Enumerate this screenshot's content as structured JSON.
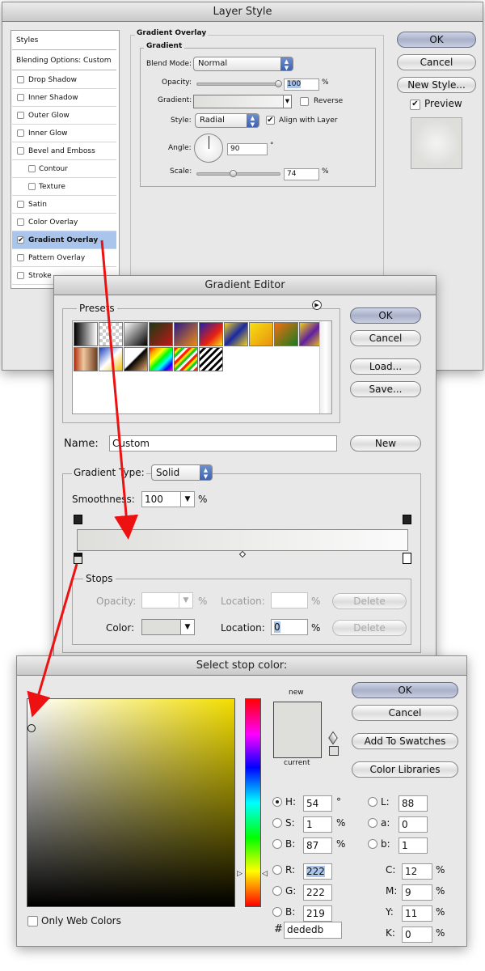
{
  "layer_style": {
    "title": "Layer Style",
    "styles_header": "Styles",
    "blending_options": "Blending Options: Custom",
    "effects": [
      {
        "label": "Drop Shadow",
        "checked": false
      },
      {
        "label": "Inner Shadow",
        "checked": false
      },
      {
        "label": "Outer Glow",
        "checked": false
      },
      {
        "label": "Inner Glow",
        "checked": false
      },
      {
        "label": "Bevel and Emboss",
        "checked": false
      },
      {
        "label": "Contour",
        "checked": false
      },
      {
        "label": "Texture",
        "checked": false
      },
      {
        "label": "Satin",
        "checked": false
      },
      {
        "label": "Color Overlay",
        "checked": false
      },
      {
        "label": "Gradient Overlay",
        "checked": true
      },
      {
        "label": "Pattern Overlay",
        "checked": false
      },
      {
        "label": "Stroke",
        "checked": false
      }
    ],
    "section_title": "Gradient Overlay",
    "group_title": "Gradient",
    "blend_mode_label": "Blend Mode:",
    "blend_mode_value": "Normal",
    "opacity_label": "Opacity:",
    "opacity_value": "100",
    "opacity_unit": "%",
    "gradient_label": "Gradient:",
    "reverse_label": "Reverse",
    "style_label": "Style:",
    "style_value": "Radial",
    "align_label": "Align with Layer",
    "angle_label": "Angle:",
    "angle_value": "90",
    "angle_unit": "°",
    "scale_label": "Scale:",
    "scale_value": "74",
    "scale_unit": "%",
    "ok": "OK",
    "cancel": "Cancel",
    "new_style": "New Style...",
    "preview": "Preview"
  },
  "gradient_editor": {
    "title": "Gradient Editor",
    "presets_label": "Presets",
    "ok": "OK",
    "cancel": "Cancel",
    "load": "Load...",
    "save": "Save...",
    "name_label": "Name:",
    "name_value": "Custom",
    "new": "New",
    "type_label": "Gradient Type:",
    "type_value": "Solid",
    "smoothness_label": "Smoothness:",
    "smoothness_value": "100",
    "smoothness_unit": "%",
    "stops_label": "Stops",
    "opacity_label": "Opacity:",
    "opacity_unit": "%",
    "location_label": "Location:",
    "location_unit": "%",
    "delete": "Delete",
    "color_label": "Color:",
    "location_value": "0"
  },
  "color_picker": {
    "title": "Select stop color:",
    "new_label": "new",
    "current_label": "current",
    "ok": "OK",
    "cancel": "Cancel",
    "add_swatches": "Add To Swatches",
    "color_libraries": "Color Libraries",
    "H": {
      "label": "H:",
      "value": "54",
      "unit": "°"
    },
    "S": {
      "label": "S:",
      "value": "1",
      "unit": "%"
    },
    "B": {
      "label": "B:",
      "value": "87",
      "unit": "%"
    },
    "R": {
      "label": "R:",
      "value": "222"
    },
    "G": {
      "label": "G:",
      "value": "222"
    },
    "Bb": {
      "label": "B:",
      "value": "219"
    },
    "L": {
      "label": "L:",
      "value": "88"
    },
    "a": {
      "label": "a:",
      "value": "0"
    },
    "b": {
      "label": "b:",
      "value": "1"
    },
    "C": {
      "label": "C:",
      "value": "12",
      "unit": "%"
    },
    "M": {
      "label": "M:",
      "value": "9",
      "unit": "%"
    },
    "Y": {
      "label": "Y:",
      "value": "11",
      "unit": "%"
    },
    "K": {
      "label": "K:",
      "value": "0",
      "unit": "%"
    },
    "hash": "#",
    "hex": "dededb",
    "web_only": "Only Web Colors"
  },
  "colors": {
    "stop_color": "#dededb",
    "selection_blue": "#a9c5ec",
    "arrow_red": "#ee1111",
    "hue_yellow": "#f3dd00"
  }
}
